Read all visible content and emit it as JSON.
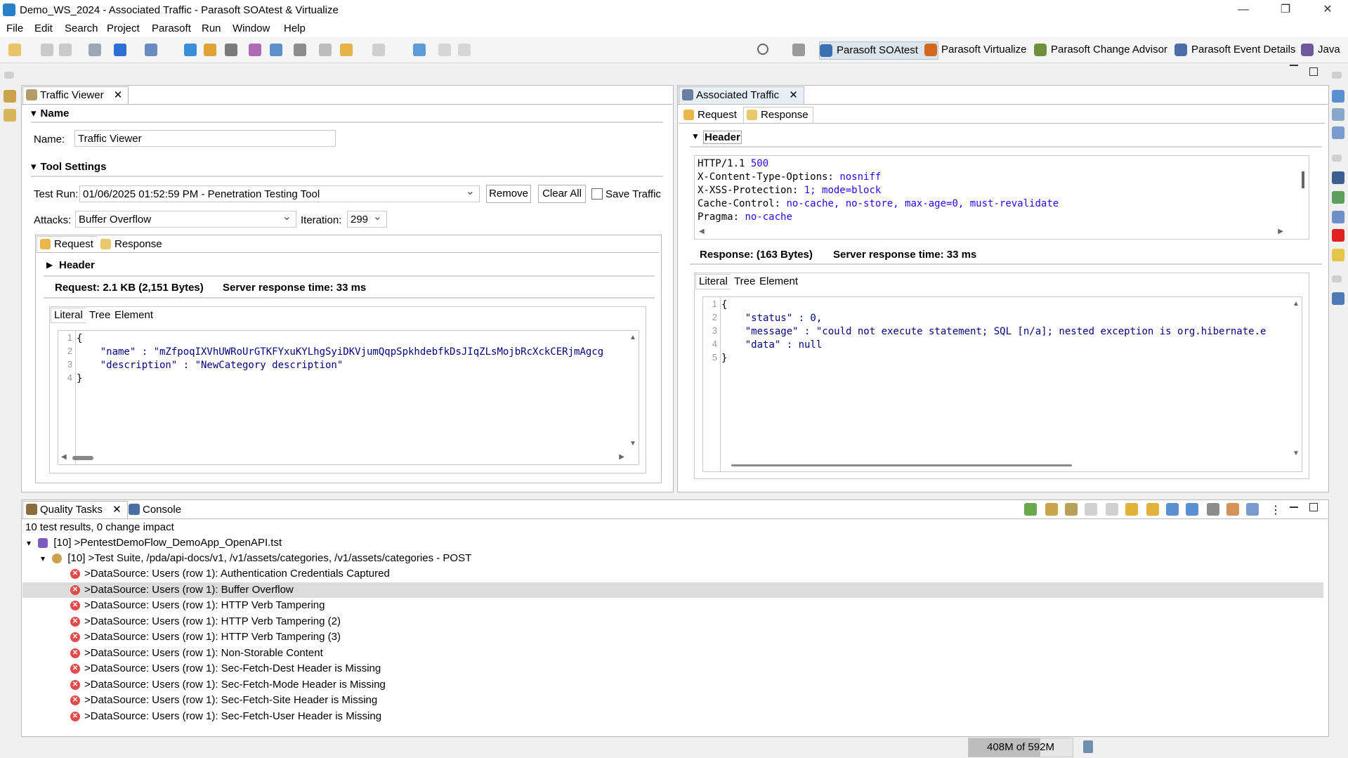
{
  "window": {
    "title": "Demo_WS_2024 - Associated Traffic - Parasoft SOAtest & Virtualize",
    "controls": [
      "—",
      "❐",
      "✕"
    ]
  },
  "menu": [
    "File",
    "Edit",
    "Search",
    "Project",
    "Parasoft",
    "Run",
    "Window",
    "Help"
  ],
  "perspectives": [
    {
      "label": "Parasoft SOAtest",
      "color": "#3a6fb0"
    },
    {
      "label": "Parasoft Virtualize",
      "color": "#d2691e"
    },
    {
      "label": "Parasoft Change Advisor",
      "color": "#6f8f3f"
    },
    {
      "label": "Parasoft Event Details",
      "color": "#4a6fa5"
    },
    {
      "label": "Java",
      "color": "#6d5a9b"
    }
  ],
  "traffic_viewer": {
    "tab_label": "Traffic Viewer",
    "name_section": "Name",
    "name_label": "Name:",
    "name_value": "Traffic Viewer",
    "tool_settings": "Tool Settings",
    "test_run_label": "Test Run:",
    "test_run_value": "01/06/2025 01:52:59 PM - Penetration Testing Tool",
    "remove_button": "Remove",
    "clear_all_button": "Clear All",
    "save_traffic_label": "Save Traffic",
    "attacks_label": "Attacks:",
    "attacks_value": "Buffer Overflow",
    "iteration_label": "Iteration:",
    "iteration_value": "299",
    "tab_request": "Request",
    "tab_response": "Response",
    "header_section": "Header",
    "request_size": "Request: 2.1 KB (2,151 Bytes)",
    "server_time": "Server response time: 33 ms",
    "view_tabs": [
      "Literal",
      "Tree",
      "Element"
    ],
    "code_lines": [
      "{",
      "    \"name\" : \"mZfpoqIXVhUWRoUrGTKFYxuKYLhgSyiDKVjumQqpSpkhdebfkDsJIqZLsMojbRcXckCERjmAgcg",
      "    \"description\" : \"NewCategory description\"",
      "}"
    ]
  },
  "associated_traffic": {
    "tab_label": "Associated Traffic",
    "tab_request": "Request",
    "tab_response": "Response",
    "header_section": "Header",
    "header_lines": [
      {
        "key": "HTTP/1.1",
        "value": "500"
      },
      {
        "key": "X-Content-Type-Options:",
        "value": "nosniff"
      },
      {
        "key": "X-XSS-Protection:",
        "value": "1; mode=block"
      },
      {
        "key": "Cache-Control:",
        "value": "no-cache, no-store, max-age=0, must-revalidate"
      },
      {
        "key": "Pragma:",
        "value": "no-cache"
      }
    ],
    "response_size": "Response: (163 Bytes)",
    "server_time": "Server response time: 33 ms",
    "view_tabs": [
      "Literal",
      "Tree",
      "Element"
    ],
    "code_lines": [
      "{",
      "    \"status\" : 0,",
      "    \"message\" : \"could not execute statement; SQL [n/a]; nested exception is org.hibernate.e",
      "    \"data\" : null",
      "}"
    ]
  },
  "quality_tasks": {
    "tab_label": "Quality Tasks",
    "console_label": "Console",
    "summary": "10 test results, 0 change impact",
    "root": "[10] >PentestDemoFlow_DemoApp_OpenAPI.tst",
    "suite": "[10] >Test Suite, /pda/api-docs/v1, /v1/assets/categories, /v1/assets/categories - POST",
    "items": [
      ">DataSource: Users (row 1): Authentication Credentials Captured",
      ">DataSource: Users (row 1): Buffer Overflow",
      ">DataSource: Users (row 1): HTTP Verb Tampering",
      ">DataSource: Users (row 1): HTTP Verb Tampering (2)",
      ">DataSource: Users (row 1): HTTP Verb Tampering (3)",
      ">DataSource: Users (row 1): Non-Storable Content",
      ">DataSource: Users (row 1): Sec-Fetch-Dest Header is Missing",
      ">DataSource: Users (row 1): Sec-Fetch-Mode Header is Missing",
      ">DataSource: Users (row 1): Sec-Fetch-Site Header is Missing",
      ">DataSource: Users (row 1): Sec-Fetch-User Header is Missing"
    ],
    "selected_index": 1
  },
  "status": {
    "memory": "408M of 592M"
  }
}
